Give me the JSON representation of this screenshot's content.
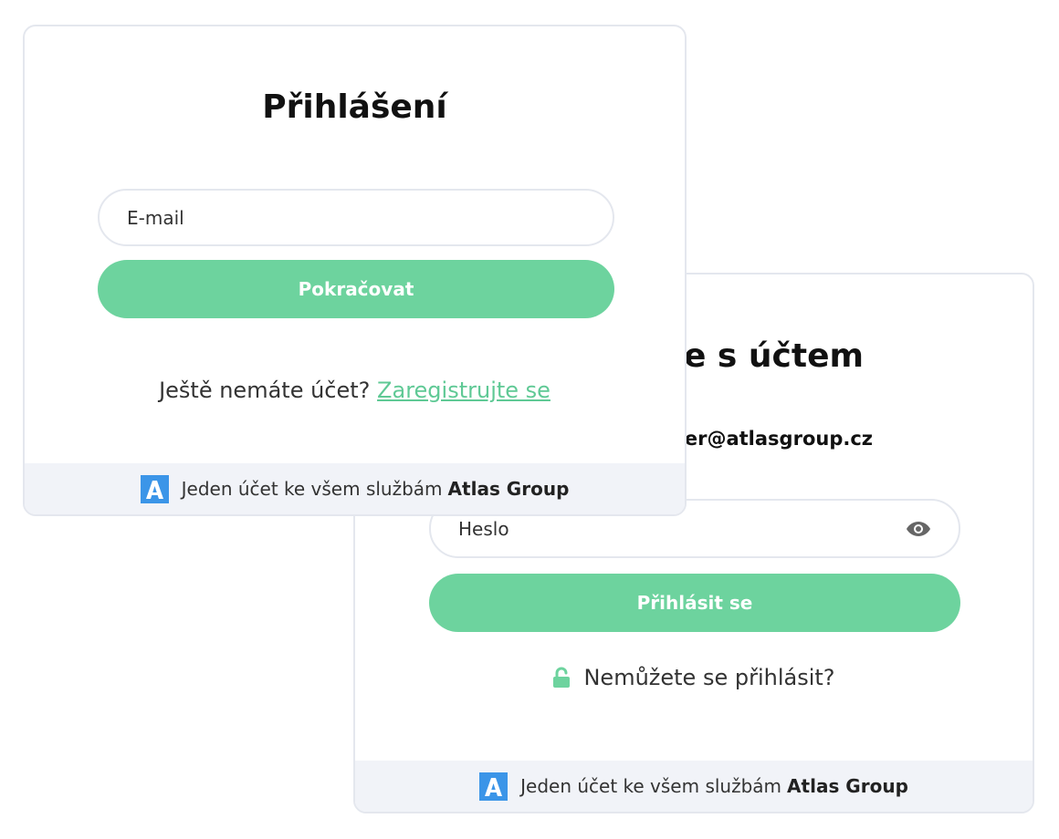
{
  "login_card": {
    "title": "Přihlášení",
    "email_placeholder": "E-mail",
    "continue_label": "Pokračovat",
    "register_prompt": "Ještě nemáte účet?",
    "register_link": "Zaregistrujte se",
    "footer_text": "Jeden účet ke všem službám",
    "footer_brand": "Atlas Group",
    "logo_icon": "atlas-logo-icon"
  },
  "password_card": {
    "title": "te s účtem",
    "email_display": "ger@atlasgroup.cz",
    "password_placeholder": "Heslo",
    "show_password_icon": "eye-icon",
    "login_label": "Přihlásit se",
    "forgot_icon": "unlock-icon",
    "forgot_label": "Nemůžete se přihlásit?",
    "footer_text": "Jeden účet ke všem službám",
    "footer_brand": "Atlas Group",
    "logo_icon": "atlas-logo-icon"
  },
  "colors": {
    "accent": "#6dd39e",
    "link": "#5fc995",
    "logo": "#3b95e8",
    "footer_bg": "#f1f3f8"
  }
}
